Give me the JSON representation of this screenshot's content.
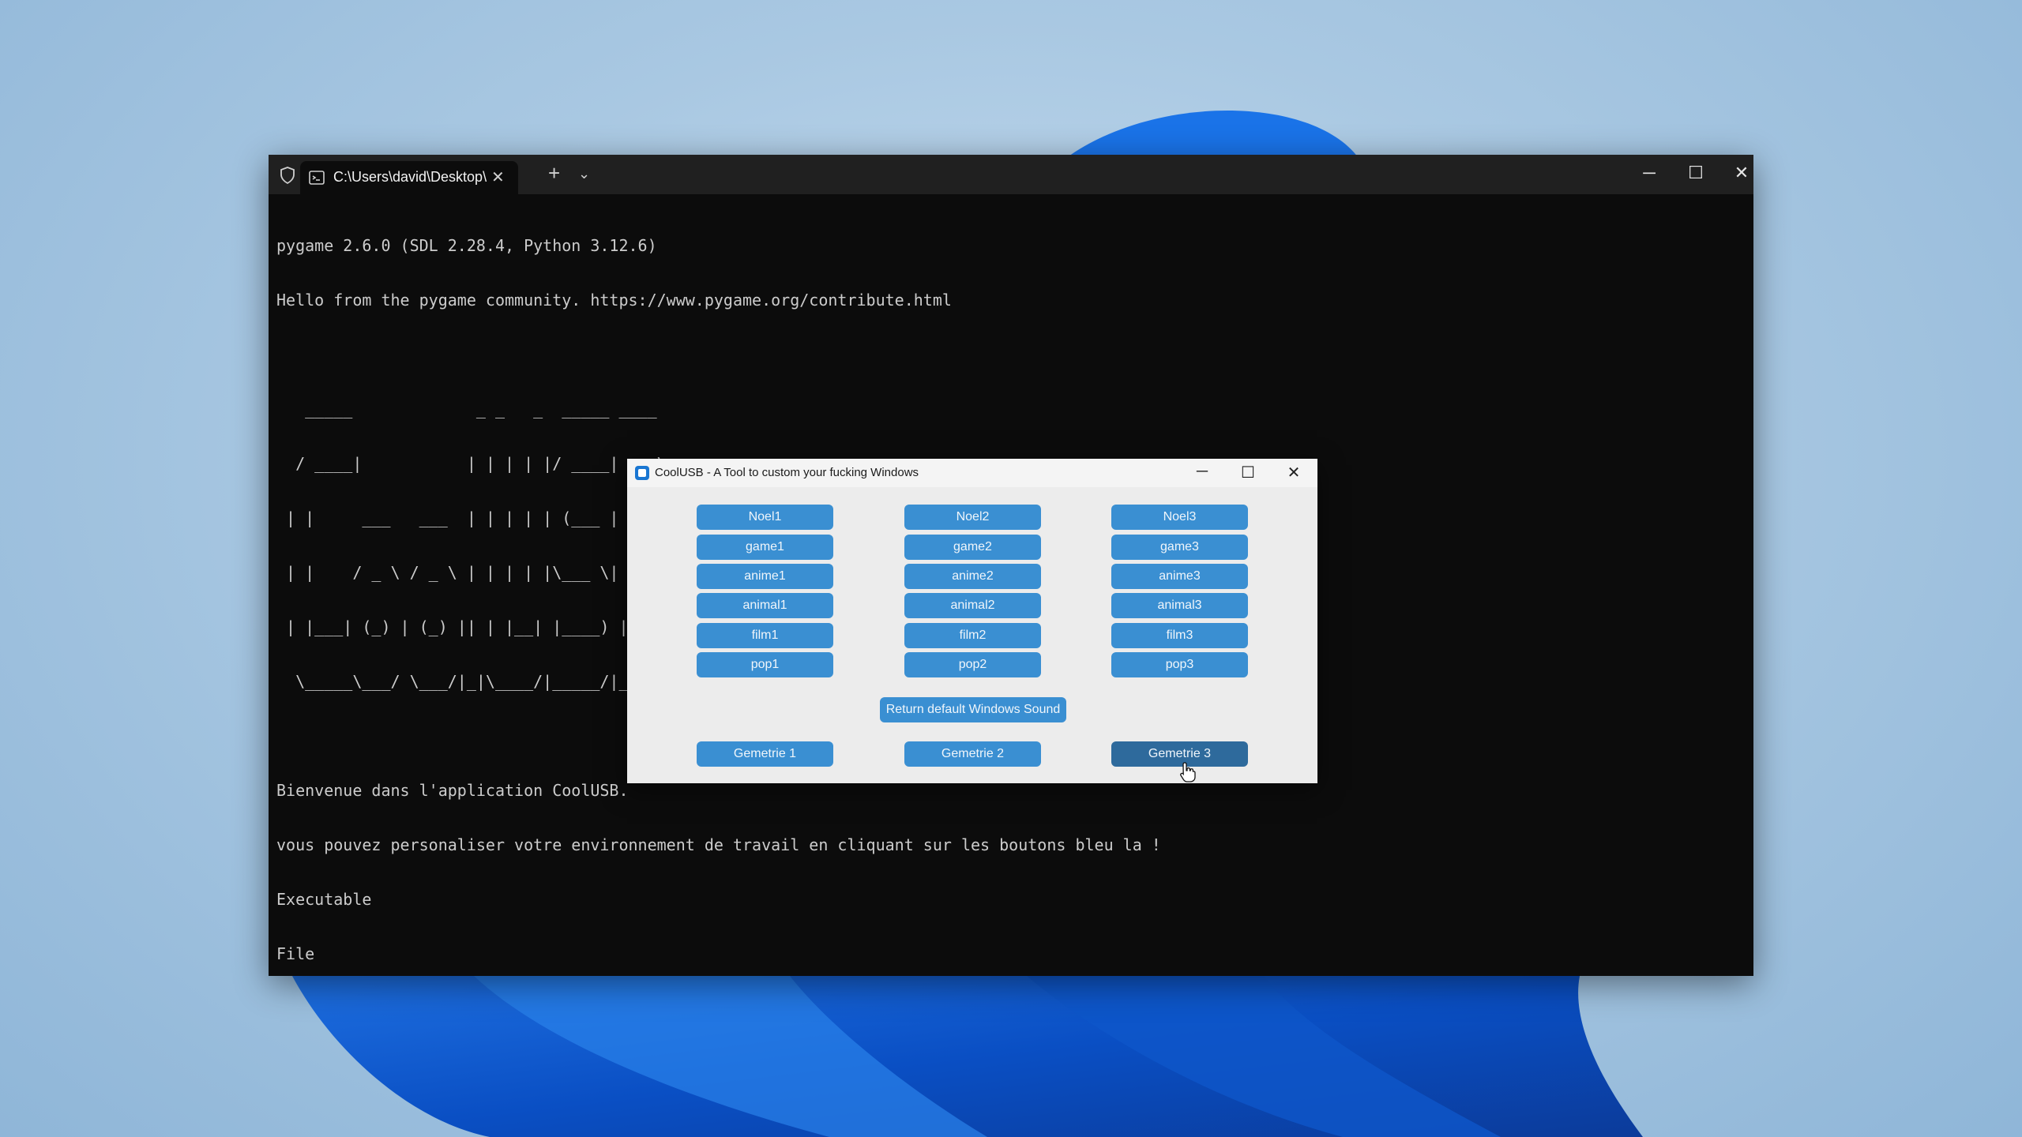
{
  "terminal": {
    "tab_title": "C:\\Users\\david\\Desktop\\",
    "tab_close": "✕",
    "new_tab": "+",
    "tab_dropdown": "⌄",
    "win_min": "─",
    "win_max": "☐",
    "win_close": "✕",
    "lines": [
      "pygame 2.6.0 (SDL 2.28.4, Python 3.12.6)",
      "Hello from the pygame community. https://www.pygame.org/contribute.html",
      "",
      "   _____             _ _   _  _____ ____  ",
      "  / ____|           | | | | |/ ____|  _ \\ ",
      " | |     ___   ___  | | | | | (___ | |_) |",
      " | |    / _ \\ / _ \\ | | | | |\\___ \\|  _ < ",
      " | |___| (_) | (_) || | |__| |____) | |_) |",
      "  \\_____\\___/ \\___/|_|\\____/|_____/|____/   Tool coded by dabergery.",
      "",
      "Bienvenue dans l'application CoolUSB.",
      "vous pouvez personaliser votre environnement de travail en cliquant sur les boutons bleu la !",
      "Executable",
      "File"
    ]
  },
  "dialog": {
    "title": "CoolUSB - A Tool to custom your fucking Windows",
    "win_min": "─",
    "win_max": "☐",
    "win_close": "✕",
    "columns": [
      [
        "Noel1",
        "game1",
        "anime1",
        "animal1",
        "film1",
        "pop1"
      ],
      [
        "Noel2",
        "game2",
        "anime2",
        "animal2",
        "film2",
        "pop2"
      ],
      [
        "Noel3",
        "game3",
        "anime3",
        "animal3",
        "film3",
        "pop3"
      ]
    ],
    "reset_label": "Return default Windows Sound",
    "gemetrie": [
      "Gemetrie 1",
      "Gemetrie 2",
      "Gemetrie 3"
    ],
    "button_color": "#3a8fd2",
    "hover_button_color": "#2e6a9c"
  }
}
